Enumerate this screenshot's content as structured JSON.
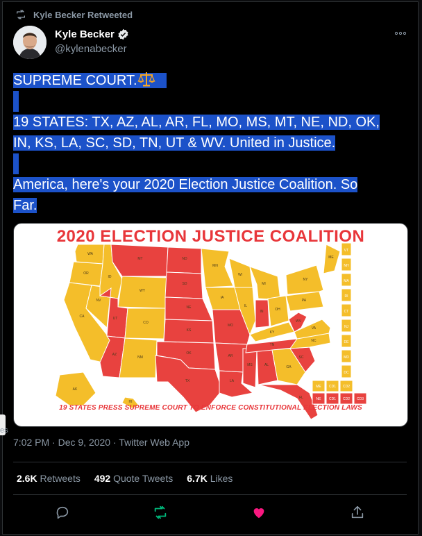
{
  "retweet_banner": {
    "label": "Kyle Becker Retweeted",
    "icon": "retweet-icon"
  },
  "author": {
    "name": "Kyle Becker",
    "handle": "@kylenabecker",
    "verified": true
  },
  "tweet": {
    "line1": "SUPREME COURT.",
    "line2": "19 STATES: TX, AZ, AL, AR, FL, MO, MS, MT, NE, ND, OK,",
    "line3": "IN, KS, LA, SC, SD, TN, UT & WV. United in Justice.",
    "line4": "America, here's your 2020 Election Justice Coalition. So",
    "line5": "Far."
  },
  "media": {
    "title": "2020 ELECTION JUSTICE COALITION",
    "footer": "19 STATES PRESS SUPREME COURT  TO ENFORCE CONSTITUTIONAL ELECTION LAWS",
    "colors": {
      "coalition": "#e8423f",
      "other": "#f4be2a",
      "title": "#e8363a"
    },
    "coalition_states": [
      "TX",
      "AZ",
      "AL",
      "AR",
      "FL",
      "MO",
      "MS",
      "MT",
      "NE",
      "ND",
      "OK",
      "IN",
      "KS",
      "LA",
      "SC",
      "SD",
      "TN",
      "UT",
      "WV"
    ],
    "labels": {
      "WA": "WA",
      "OR": "OR",
      "CA": "CA",
      "NV": "NV",
      "ID": "ID",
      "MT": "MT",
      "WY": "WY",
      "UT": "UT",
      "AZ": "AZ",
      "CO": "CO",
      "NM": "NM",
      "ND": "ND",
      "SD": "SD",
      "NE": "NE",
      "KS": "KS",
      "OK": "OK",
      "TX": "TX",
      "MN": "MN",
      "IA": "IA",
      "MO": "MO",
      "AR": "AR",
      "LA": "LA",
      "WI": "WI",
      "IL": "IL",
      "MS": "MS",
      "MI": "MI",
      "IN": "IN",
      "OH": "OH",
      "KY": "KY",
      "TN": "TN",
      "AL": "AL",
      "GA": "GA",
      "FL": "FL",
      "SC": "SC",
      "NC": "NC",
      "VA": "VA",
      "WV": "WV",
      "PA": "PA",
      "NY": "NY",
      "ME": "ME",
      "AK": "AK",
      "HI": "HI"
    },
    "ne_box_labels": [
      "VT",
      "NH",
      "MA",
      "RI",
      "CT",
      "NJ",
      "DE",
      "MD",
      "DC"
    ],
    "district_row1": [
      "ME",
      "CD1",
      "CD2"
    ],
    "district_row2": [
      "NE",
      "CD1",
      "CD2",
      "CD3"
    ]
  },
  "meta": {
    "time": "7:02 PM",
    "sep1": "·",
    "date": "Dec 9, 2020",
    "sep2": "·",
    "client": "Twitter Web App"
  },
  "stats": {
    "retweets_count": "2.6K",
    "retweets_label": "Retweets",
    "quotes_count": "492",
    "quotes_label": "Quote Tweets",
    "likes_count": "6.7K",
    "likes_label": "Likes"
  },
  "side_clip": "es"
}
